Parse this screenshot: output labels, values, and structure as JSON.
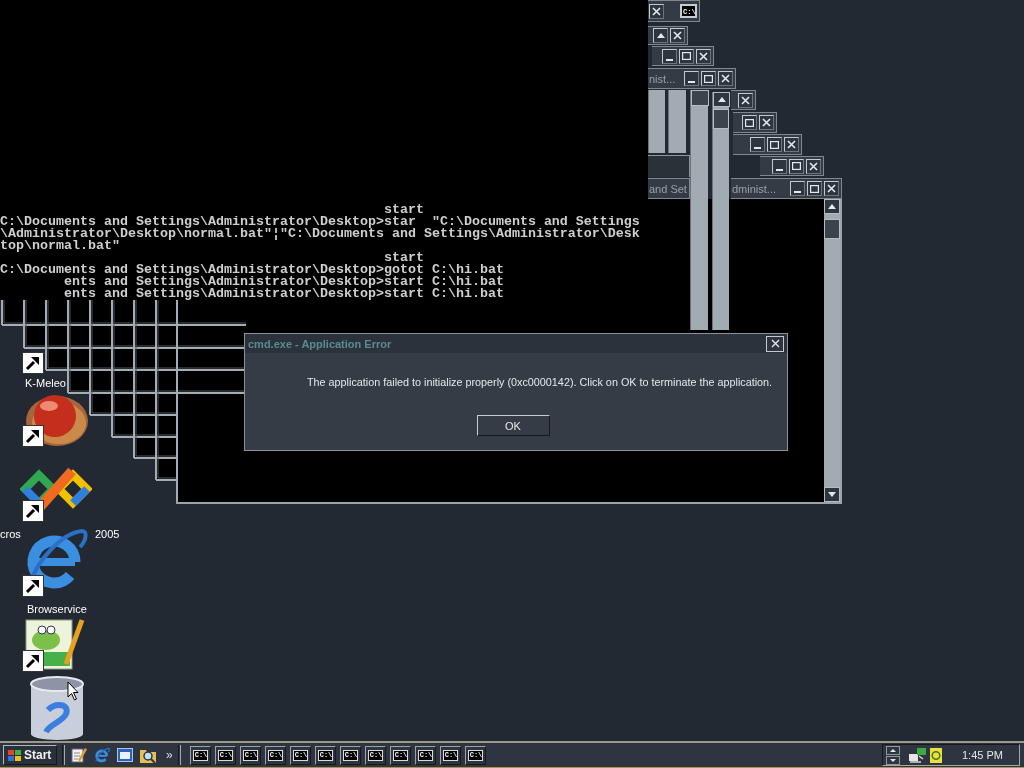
{
  "console": {
    "lines": [
      "                                                start",
      "C:\\Documents and Settings\\Administrator\\Desktop>star  \"C:\\Documents and Settings",
      "\\Administrator\\Desktop\\normal.bat\"¦\"C:\\Documents and Settings\\Administrator\\Desk",
      "top\\normal.bat\"",
      "                                                start",
      "C:\\Documents and Settings\\Administrator\\Desktop>gotot C:\\hi.bat",
      "        ents and Settings\\Administrator\\Desktop>start C:\\hi.bat",
      "        ents and Settings\\Administrator\\Desktop>start C:\\hi.bat"
    ]
  },
  "window_stack": [
    {
      "controls": [
        {
          "kind": "close"
        }
      ],
      "icon_text": "C:\\"
    },
    {
      "controls": [
        {
          "kind": "scroll-up"
        },
        {
          "kind": "close"
        }
      ]
    },
    {
      "controls": [
        {
          "kind": "minimize"
        },
        {
          "kind": "maximize"
        },
        {
          "kind": "close"
        }
      ]
    },
    {
      "title": "nist...",
      "controls": [
        {
          "kind": "minimize"
        },
        {
          "kind": "maximize"
        },
        {
          "kind": "close"
        }
      ]
    },
    {
      "controls": [
        {
          "kind": "close"
        }
      ]
    },
    {
      "controls": [
        {
          "kind": "maximize"
        },
        {
          "kind": "close"
        }
      ]
    },
    {
      "controls": [
        {
          "kind": "minimize"
        },
        {
          "kind": "maximize"
        },
        {
          "kind": "close"
        }
      ]
    },
    {
      "controls": [
        {
          "kind": "minimize"
        },
        {
          "kind": "maximize"
        },
        {
          "kind": "close"
        }
      ]
    },
    {
      "title": "and Set"
    },
    {
      "title": "dminist...",
      "controls": [
        {
          "kind": "minimize"
        },
        {
          "kind": "maximize"
        },
        {
          "kind": "close"
        }
      ]
    }
  ],
  "dialog": {
    "title": "cmd.exe - Application Error",
    "message": "The application failed to initialize properly (0xc0000142). Click on OK to terminate the application.",
    "buttons": [
      "OK"
    ]
  },
  "desktop_icons": [
    {
      "label": "K-Meleo",
      "shortcut": true
    },
    {
      "kind": "ball",
      "shortcut": true
    },
    {
      "kind": "ribbon",
      "label_pieces": [
        "cros",
        "2005"
      ],
      "shortcut": true
    },
    {
      "kind": "e-logo",
      "label": "Browservice",
      "shortcut": true
    },
    {
      "kind": "paper-pencil",
      "shortcut": true
    },
    {
      "kind": "bin",
      "shortcut": false
    }
  ],
  "taskbar": {
    "start_button": "Start",
    "quick_launch": [
      {
        "kind": "doc-pencil"
      },
      {
        "kind": "e-logo"
      },
      {
        "kind": "window"
      },
      {
        "kind": "magnifier-folder"
      }
    ],
    "more_button": "»",
    "tasks": [
      {
        "icon_text": "C:\\",
        "selected": false
      },
      {
        "icon_text": "C:\\",
        "selected": false
      },
      {
        "icon_text": "C:\\",
        "selected": false
      },
      {
        "icon_text": "C:\\",
        "selected": false
      },
      {
        "icon_text": "C:\\",
        "selected": false
      },
      {
        "icon_text": "C:\\",
        "selected": false
      },
      {
        "icon_text": "C:\\",
        "selected": false
      },
      {
        "icon_text": "C:\\",
        "selected": false
      },
      {
        "icon_text": "C:\\",
        "selected": false
      },
      {
        "icon_text": "C:\\",
        "selected": false
      },
      {
        "icon_text": "C:\\",
        "selected": false
      },
      {
        "icon_text": "C:\\",
        "selected": false
      }
    ],
    "tray": {
      "icons": [
        {
          "kind": "network"
        },
        {
          "kind": "smiley"
        }
      ],
      "clock": "1:45 PM"
    }
  }
}
